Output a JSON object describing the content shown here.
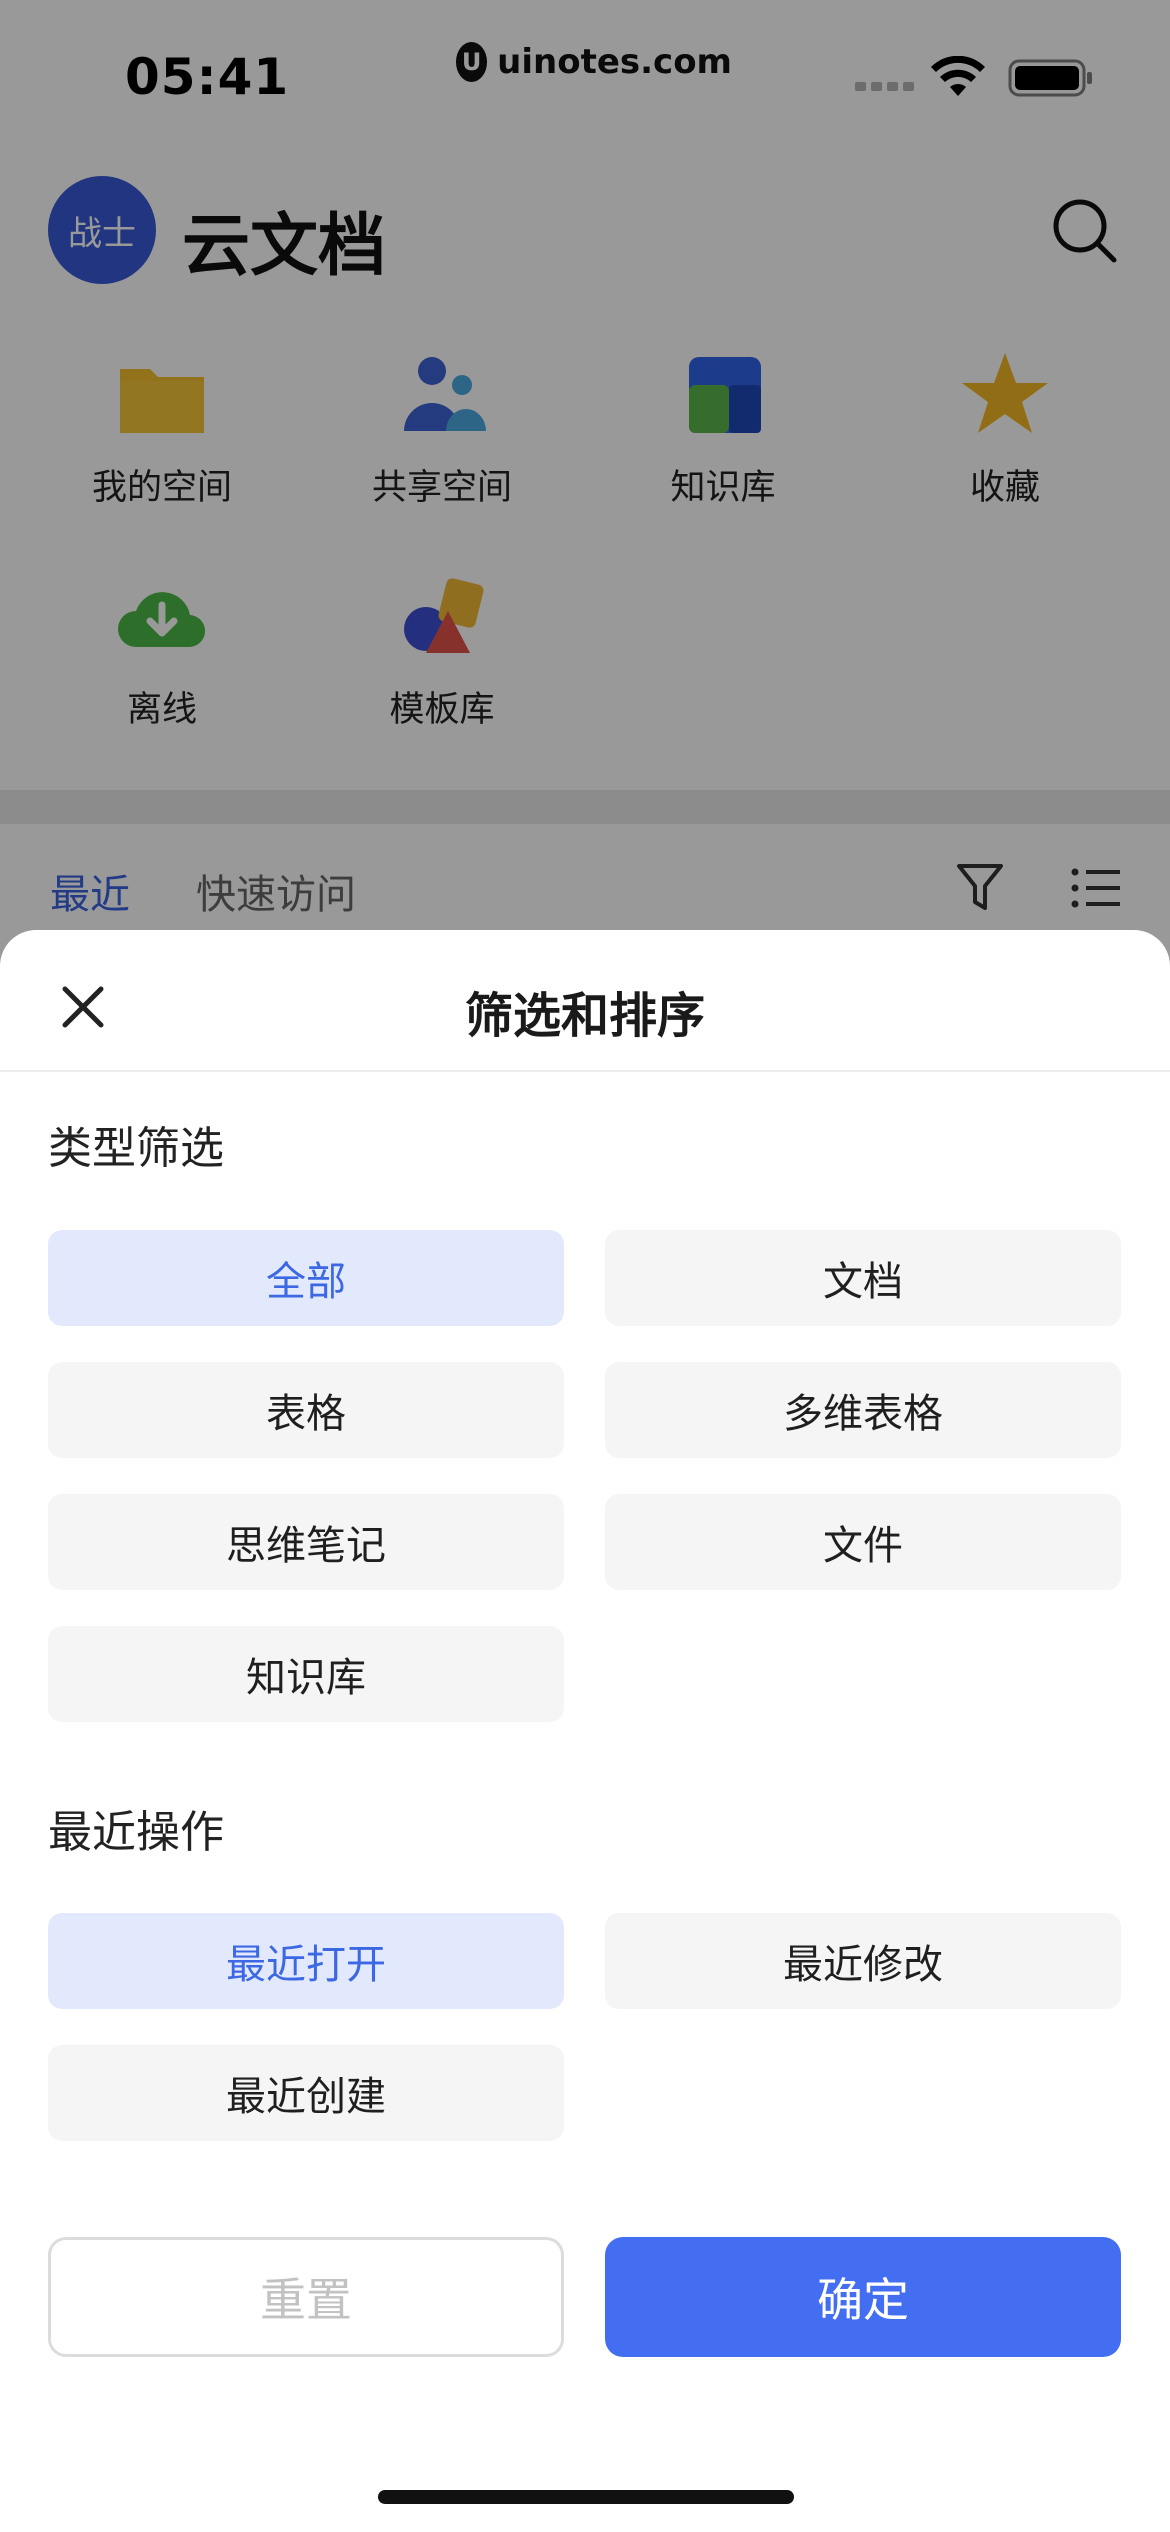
{
  "status_bar": {
    "time": "05:41",
    "watermark_text": "uinotes.com",
    "watermark_logo": "U"
  },
  "header": {
    "avatar_text": "战士",
    "title": "云文档"
  },
  "quick_access": [
    {
      "label": "我的空间",
      "icon": "folder-icon",
      "color": "#f3c02f"
    },
    {
      "label": "共享空间",
      "icon": "people-icon",
      "color": "#3f63d6"
    },
    {
      "label": "知识库",
      "icon": "knowledge-base-icon",
      "color": "#2f63e8"
    },
    {
      "label": "收藏",
      "icon": "star-icon",
      "color": "#f2b624"
    },
    {
      "label": "离线",
      "icon": "cloud-download-icon",
      "color": "#4cb849"
    },
    {
      "label": "模板库",
      "icon": "template-shapes-icon",
      "color": "#f0b836"
    }
  ],
  "recent_tabs": {
    "recent": "最近",
    "quick_visit": "快速访问"
  },
  "sheet": {
    "title": "筛选和排序",
    "type_filter": {
      "label": "类型筛选",
      "options": [
        {
          "label": "全部",
          "selected": true
        },
        {
          "label": "文档",
          "selected": false
        },
        {
          "label": "表格",
          "selected": false
        },
        {
          "label": "多维表格",
          "selected": false
        },
        {
          "label": "思维笔记",
          "selected": false
        },
        {
          "label": "文件",
          "selected": false
        },
        {
          "label": "知识库",
          "selected": false
        }
      ]
    },
    "recent_ops": {
      "label": "最近操作",
      "options": [
        {
          "label": "最近打开",
          "selected": true
        },
        {
          "label": "最近修改",
          "selected": false
        },
        {
          "label": "最近创建",
          "selected": false
        }
      ]
    },
    "reset_label": "重置",
    "confirm_label": "确定"
  },
  "colors": {
    "accent": "#446ef2",
    "selected_bg": "#e2e9fd",
    "selected_text": "#3d68e4",
    "option_bg": "#f5f5f5"
  }
}
